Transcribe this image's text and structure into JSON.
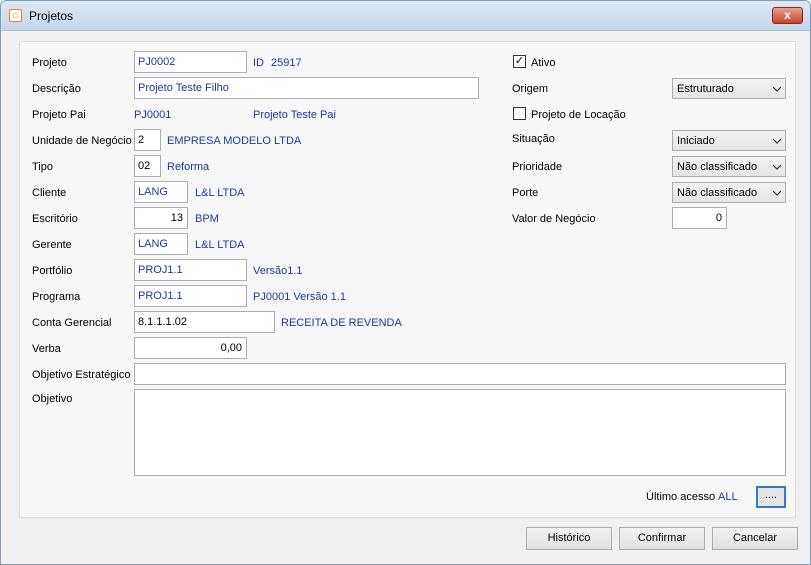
{
  "window": {
    "title": "Projetos",
    "icon": "app-logo-icon",
    "close_glyph": "x"
  },
  "form": {
    "projeto": {
      "label": "Projeto",
      "value": "PJ0002",
      "id_label": "ID",
      "id_value": "25917"
    },
    "descricao": {
      "label": "Descrição",
      "value": "Projeto Teste Filho"
    },
    "projeto_pai": {
      "label": "Projeto Pai",
      "code": "PJ0001",
      "name": "Projeto Teste Pai"
    },
    "unidade_negocio": {
      "label": "Unidade de Negócio",
      "value": "2",
      "name": "EMPRESA MODELO LTDA"
    },
    "tipo": {
      "label": "Tipo",
      "value": "02",
      "name": "Reforma"
    },
    "cliente": {
      "label": "Cliente",
      "value": "LANG",
      "name": "L&L LTDA"
    },
    "escritorio": {
      "label": "Escritório",
      "value": "13",
      "name": "BPM"
    },
    "gerente": {
      "label": "Gerente",
      "value": "LANG",
      "name": "L&L LTDA"
    },
    "portfolio": {
      "label": "Portfólio",
      "value": "PROJ1.1",
      "name": "Versão1.1"
    },
    "programa": {
      "label": "Programa",
      "value": "PROJ1.1",
      "name": "PJ0001 Versão 1.1"
    },
    "conta_gerencial": {
      "label": "Conta Gerencial",
      "value": "8.1.1.1.02",
      "name": "RECEITA DE REVENDA"
    },
    "verba": {
      "label": "Verba",
      "value": "0,00"
    },
    "objetivo_estrategico": {
      "label": "Objetivo Estratégico",
      "value": ""
    },
    "objetivo": {
      "label": "Objetivo",
      "value": ""
    },
    "ativo": {
      "label": "Ativo",
      "checked": true,
      "check_glyph": "✓"
    },
    "origem": {
      "label": "Origem",
      "value": "Estruturado"
    },
    "projeto_locacao": {
      "label": "Projeto de Locação",
      "checked": false
    },
    "situacao": {
      "label": "Situação",
      "value": "Iniciado"
    },
    "prioridade": {
      "label": "Prioridade",
      "value": "Não classificado"
    },
    "porte": {
      "label": "Porte",
      "value": "Não classificado"
    },
    "valor_negocio": {
      "label": "Valor de Negócio",
      "value": "0"
    },
    "ultimo_acesso": {
      "label": "Último acesso",
      "value": "ALL",
      "button_label": "...."
    }
  },
  "buttons": {
    "historico": "Histórico",
    "confirmar": "Confirmar",
    "cancelar": "Cancelar"
  }
}
